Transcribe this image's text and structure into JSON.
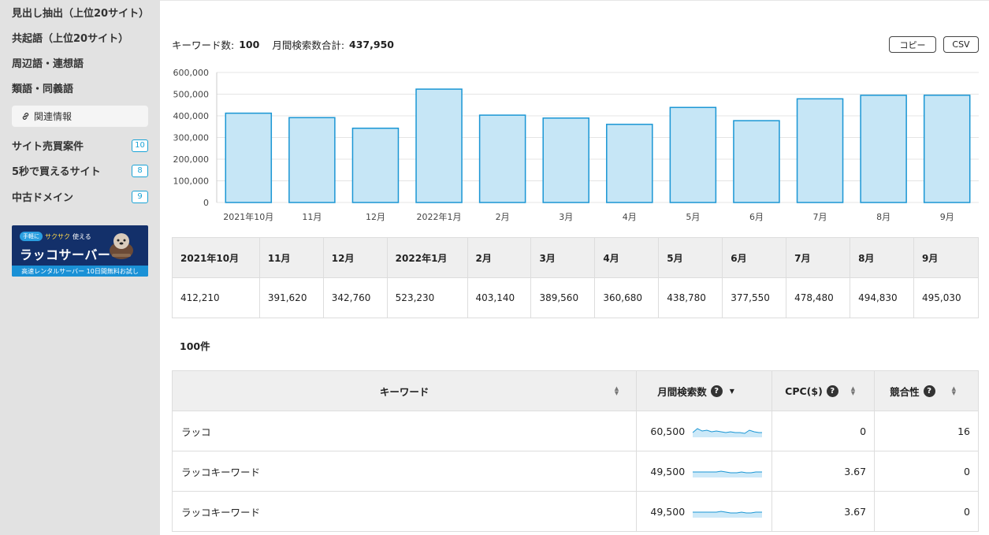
{
  "sidebar": {
    "links": [
      "見出し抽出（上位20サイト）",
      "共起語（上位20サイト）",
      "周辺語・連想語",
      "類語・同義語"
    ],
    "related_label": "関連情報",
    "rows": [
      {
        "label": "サイト売買案件",
        "badge": "10"
      },
      {
        "label": "5秒で買えるサイト",
        "badge": "8"
      },
      {
        "label": "中古ドメイン",
        "badge": "9"
      }
    ],
    "banner": {
      "pill": "手軽に",
      "tagline_yellow": "サクサク",
      "tagline_white": "使える",
      "title": "ラッコサーバー",
      "bottom": "高速レンタルサーバー 10日間無料お試し"
    }
  },
  "summary": {
    "keyword_count_label": "キーワード数:",
    "keyword_count": "100",
    "total_label": "月間検索数合計:",
    "total": "437,950"
  },
  "buttons": {
    "copy": "コピー",
    "csv": "CSV"
  },
  "chart_data": {
    "type": "bar",
    "categories": [
      "2021年10月",
      "11月",
      "12月",
      "2022年1月",
      "2月",
      "3月",
      "4月",
      "5月",
      "6月",
      "7月",
      "8月",
      "9月"
    ],
    "values": [
      412210,
      391620,
      342760,
      523230,
      403140,
      389560,
      360680,
      438780,
      377550,
      478480,
      494830,
      495030
    ],
    "yticks": [
      "0",
      "100,000",
      "200,000",
      "300,000",
      "400,000",
      "500,000",
      "600,000"
    ],
    "ylim": [
      0,
      600000
    ],
    "bar_fill": "#c6e6f6",
    "bar_stroke": "#1a96d4",
    "grid": true
  },
  "monthly_table": {
    "headers": [
      "2021年10月",
      "11月",
      "12月",
      "2022年1月",
      "2月",
      "3月",
      "4月",
      "5月",
      "6月",
      "7月",
      "8月",
      "9月"
    ],
    "values": [
      "412,210",
      "391,620",
      "342,760",
      "523,230",
      "403,140",
      "389,560",
      "360,680",
      "438,780",
      "377,550",
      "478,480",
      "494,830",
      "495,030"
    ]
  },
  "result_count": "100件",
  "keyword_table": {
    "headers": {
      "keyword": "キーワード",
      "volume": "月間検索数",
      "cpc": "CPC($)",
      "competition": "競合性"
    },
    "rows": [
      {
        "keyword": "ラッコ",
        "volume": "60,500",
        "cpc": "0",
        "competition": "16"
      },
      {
        "keyword": "ラッコキーワード",
        "volume": "49,500",
        "cpc": "3.67",
        "competition": "0"
      },
      {
        "keyword": "ラッコキーワード",
        "volume": "49,500",
        "cpc": "3.67",
        "competition": "0"
      }
    ]
  }
}
